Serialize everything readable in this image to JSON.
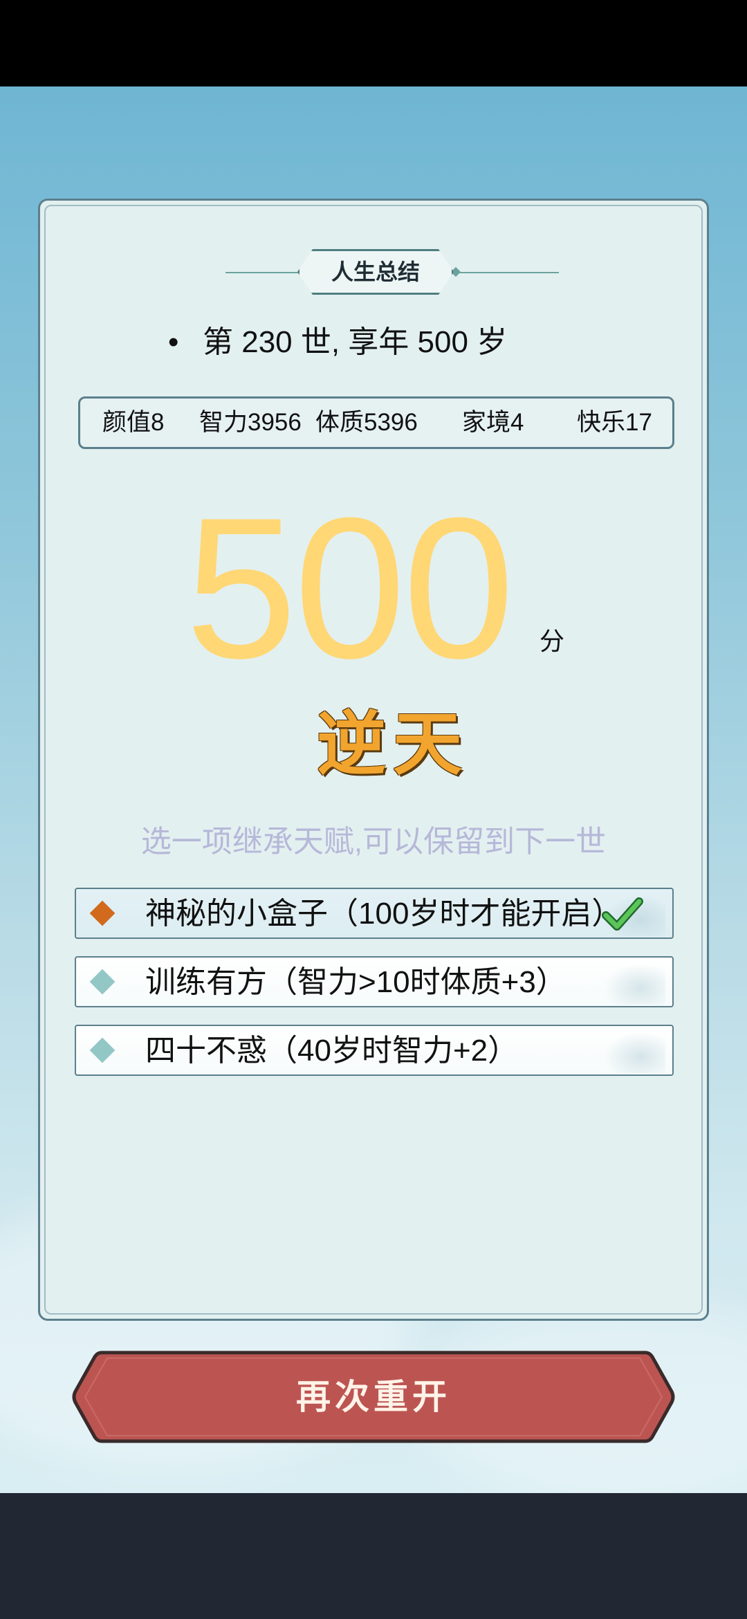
{
  "summary_title": "人生总结",
  "life_line": "第 230 世, 享年 500 岁",
  "stats": {
    "appearance": "颜值8",
    "intelligence": "智力3956",
    "constitution": "体质5396",
    "family": "家境4",
    "happiness": "快乐17"
  },
  "score": {
    "value": "500",
    "unit": "分",
    "rank": "逆天"
  },
  "inherit_prompt": "选一项继承天赋,可以保留到下一世",
  "talents": [
    {
      "label": "神秘的小盒子（100岁时才能开启）",
      "selected": true
    },
    {
      "label": "训练有方（智力>10时体质+3）",
      "selected": false
    },
    {
      "label": "四十不惑（40岁时智力+2）",
      "selected": false
    }
  ],
  "restart_label": "再次重开",
  "colors": {
    "score": "#ffd774",
    "rank": "#f2a52e",
    "button": "#bc5552",
    "selected_diamond": "#d16a1d",
    "diamond": "#93c7c6",
    "prompt": "#b6b8d8"
  },
  "icons": {
    "selected_mark": "check-icon",
    "bullet": "diamond-icon"
  }
}
